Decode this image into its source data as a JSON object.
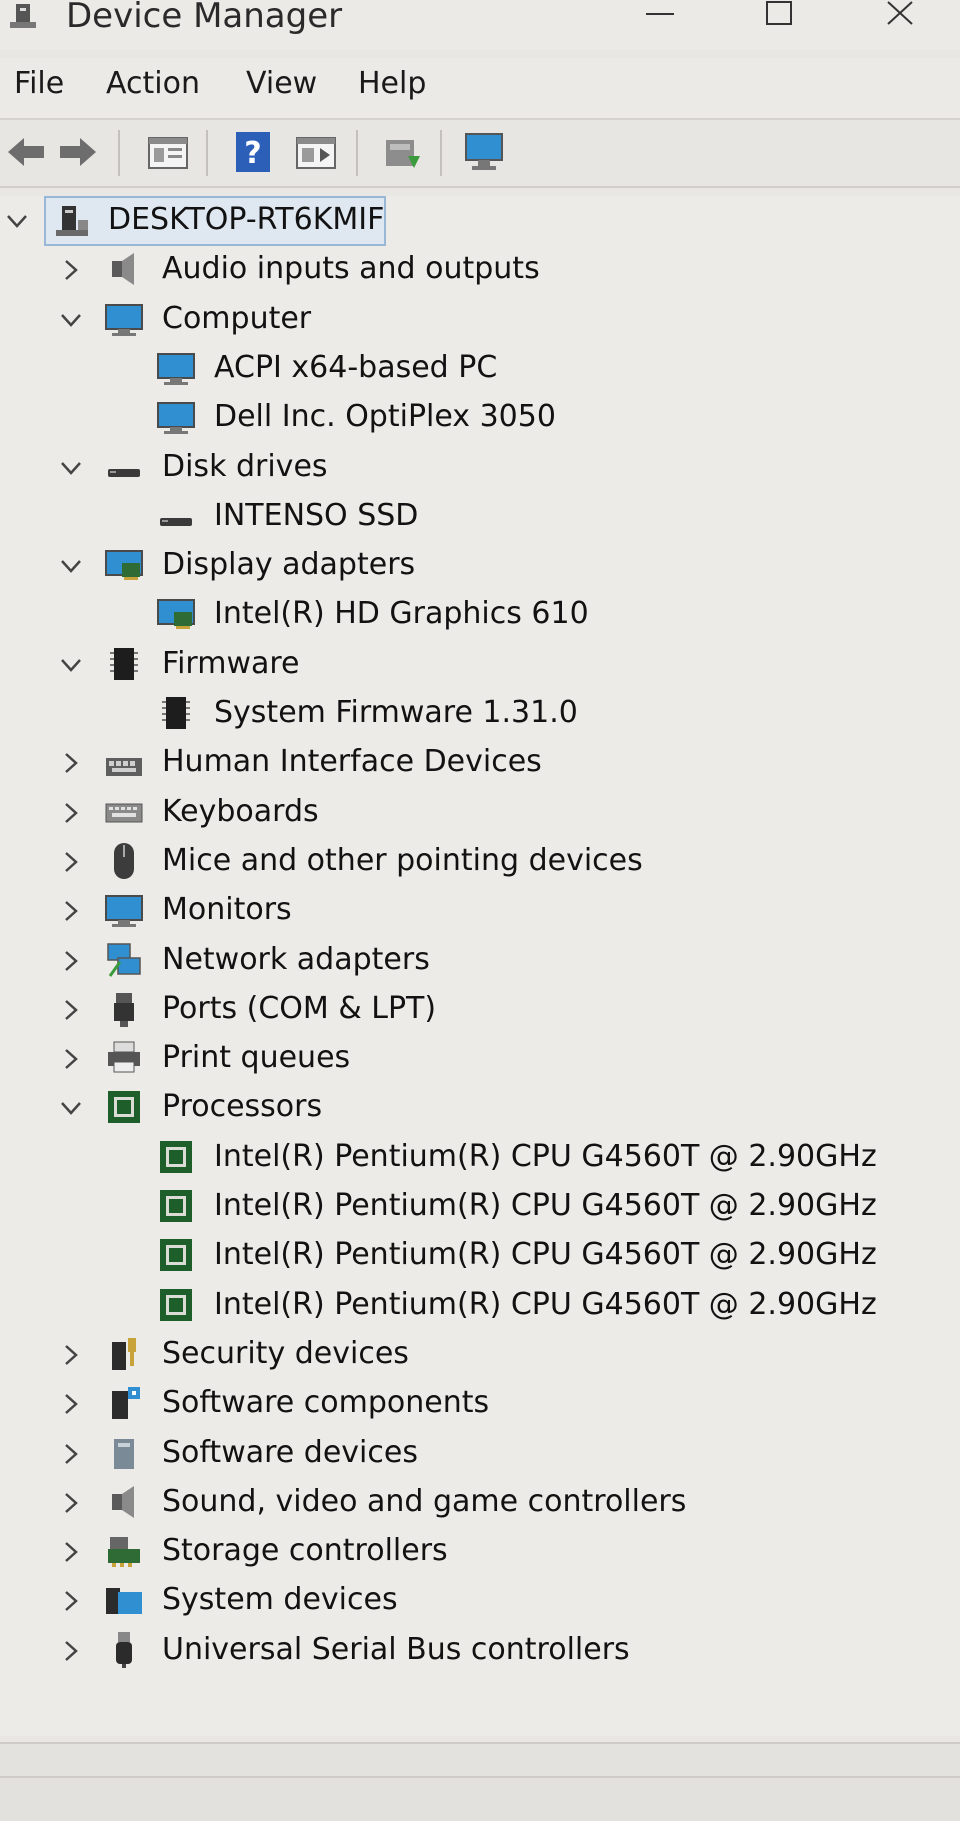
{
  "window": {
    "title": "Device Manager",
    "icons": {
      "app": "device-manager-icon",
      "minimize": "minimize-icon",
      "maximize": "maximize-icon",
      "close": "close-icon"
    }
  },
  "menu": {
    "file": "File",
    "action": "Action",
    "view": "View",
    "help": "Help"
  },
  "toolbar": {
    "icons": [
      "back-arrow-icon",
      "forward-arrow-icon",
      "properties-icon",
      "help-icon",
      "show-hidden-icon",
      "update-driver-icon",
      "scan-hardware-icon"
    ]
  },
  "tree": {
    "root": {
      "label": "DESKTOP-RT6KMIF",
      "expanded": true,
      "icon": "computer-tower-icon"
    },
    "categories": [
      {
        "label": "Audio inputs and outputs",
        "expanded": false,
        "icon": "speaker-icon"
      },
      {
        "label": "Computer",
        "expanded": true,
        "icon": "monitor-icon",
        "children": [
          "ACPI x64-based PC",
          "Dell Inc. OptiPlex 3050"
        ]
      },
      {
        "label": "Disk drives",
        "expanded": true,
        "icon": "disk-drive-icon",
        "children": [
          "INTENSO SSD"
        ]
      },
      {
        "label": "Display adapters",
        "expanded": true,
        "icon": "display-adapter-icon",
        "children": [
          "Intel(R) HD Graphics 610"
        ]
      },
      {
        "label": "Firmware",
        "expanded": true,
        "icon": "firmware-chip-icon",
        "children": [
          "System Firmware 1.31.0"
        ]
      },
      {
        "label": "Human Interface Devices",
        "expanded": false,
        "icon": "hid-icon"
      },
      {
        "label": "Keyboards",
        "expanded": false,
        "icon": "keyboard-icon"
      },
      {
        "label": "Mice and other pointing devices",
        "expanded": false,
        "icon": "mouse-icon"
      },
      {
        "label": "Monitors",
        "expanded": false,
        "icon": "monitor-icon"
      },
      {
        "label": "Network adapters",
        "expanded": false,
        "icon": "network-icon"
      },
      {
        "label": "Ports (COM & LPT)",
        "expanded": false,
        "icon": "port-icon"
      },
      {
        "label": "Print queues",
        "expanded": false,
        "icon": "printer-icon"
      },
      {
        "label": "Processors",
        "expanded": true,
        "icon": "processor-icon",
        "children": [
          "Intel(R) Pentium(R) CPU G4560T @ 2.90GHz",
          "Intel(R) Pentium(R) CPU G4560T @ 2.90GHz",
          "Intel(R) Pentium(R) CPU G4560T @ 2.90GHz",
          "Intel(R) Pentium(R) CPU G4560T @ 2.90GHz"
        ]
      },
      {
        "label": "Security devices",
        "expanded": false,
        "icon": "security-icon"
      },
      {
        "label": "Software components",
        "expanded": false,
        "icon": "software-component-icon"
      },
      {
        "label": "Software devices",
        "expanded": false,
        "icon": "software-device-icon"
      },
      {
        "label": "Sound, video and game controllers",
        "expanded": false,
        "icon": "speaker-icon"
      },
      {
        "label": "Storage controllers",
        "expanded": false,
        "icon": "storage-controller-icon"
      },
      {
        "label": "System devices",
        "expanded": false,
        "icon": "system-folder-icon"
      },
      {
        "label": "Universal Serial Bus controllers",
        "expanded": false,
        "icon": "usb-icon"
      }
    ]
  },
  "colors": {
    "background": "#edebe7",
    "selection_border": "#9bb7d8",
    "monitor_blue": "#2f8fd1",
    "chip_green": "#1e5e2a"
  }
}
